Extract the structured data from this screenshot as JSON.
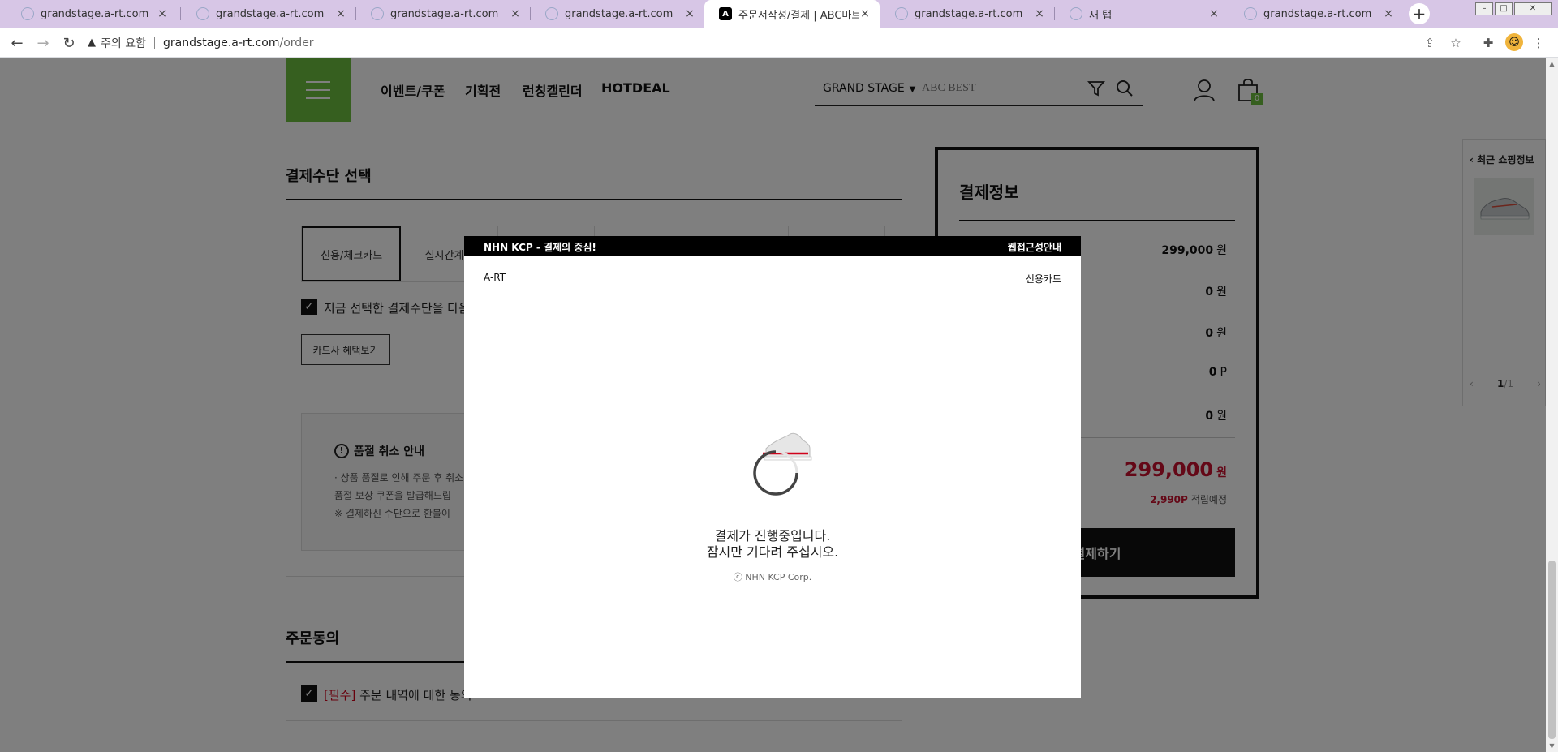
{
  "browser": {
    "tabs": [
      {
        "title": "grandstage.a-rt.com",
        "active": false
      },
      {
        "title": "grandstage.a-rt.com",
        "active": false
      },
      {
        "title": "grandstage.a-rt.com",
        "active": false
      },
      {
        "title": "grandstage.a-rt.com",
        "active": false
      },
      {
        "title": "주문서작성/결제 | ABC마트",
        "active": true
      },
      {
        "title": "grandstage.a-rt.com",
        "active": false
      },
      {
        "title": "새 탭",
        "active": false
      },
      {
        "title": "grandstage.a-rt.com",
        "active": false
      }
    ],
    "tab_close": "×",
    "new_tab": "+",
    "security_warning": "주의 요함",
    "url_host": "grandstage.a-rt.com",
    "url_path": "/order"
  },
  "header": {
    "nav": [
      "이벤트/쿠폰",
      "기획전",
      "런칭캘린더",
      "HOTDEAL"
    ],
    "search_brand": "GRAND STAGE",
    "search_placeholder": "ABC BEST",
    "cart_count": "0",
    "brand_color": "#6cbf3f"
  },
  "payment": {
    "section_title": "결제수단 선택",
    "tabs": [
      "신용/체크카드",
      "실시간계좌",
      "",
      "",
      "",
      ""
    ],
    "remember_label": "지금 선택한 결제수단을 다음에도 사용",
    "benefits_button": "카드사 혜택보기"
  },
  "notice": {
    "title": "품절 취소 안내",
    "lines": [
      "· 상품 품절로 인해 주문 후 취소",
      "  품절 보상 쿠폰을 발급해드립",
      "  ※ 결제하신 수단으로 환불이"
    ]
  },
  "agreement": {
    "section_title": "주문동의",
    "required_tag": "[필수]",
    "label": "주문 내역에 대한 동의"
  },
  "summary": {
    "title": "결제정보",
    "rows": [
      {
        "value": "299,000",
        "unit": "원"
      },
      {
        "value": "0",
        "unit": "원"
      },
      {
        "value": "0",
        "unit": "원"
      },
      {
        "value": "0",
        "unit": "P"
      },
      {
        "value": "0",
        "unit": "원"
      }
    ],
    "total": "299,000",
    "total_unit": "원",
    "points": "2,990P",
    "points_label": "적립예정",
    "pay_button": "결제하기",
    "accent_color": "#c8102e"
  },
  "recent": {
    "title": "최근 쇼핑정보",
    "page_current": "1",
    "page_total": "/1"
  },
  "modal": {
    "header_left": "NHN KCP - 결제의 중심!",
    "header_right": "웹접근성안내",
    "merchant": "A-RT",
    "method": "신용카드",
    "message_line1": "결제가 진행중입니다.",
    "message_line2": "잠시만 기다려 주십시오.",
    "copyright": "ⓒ NHN KCP Corp."
  }
}
